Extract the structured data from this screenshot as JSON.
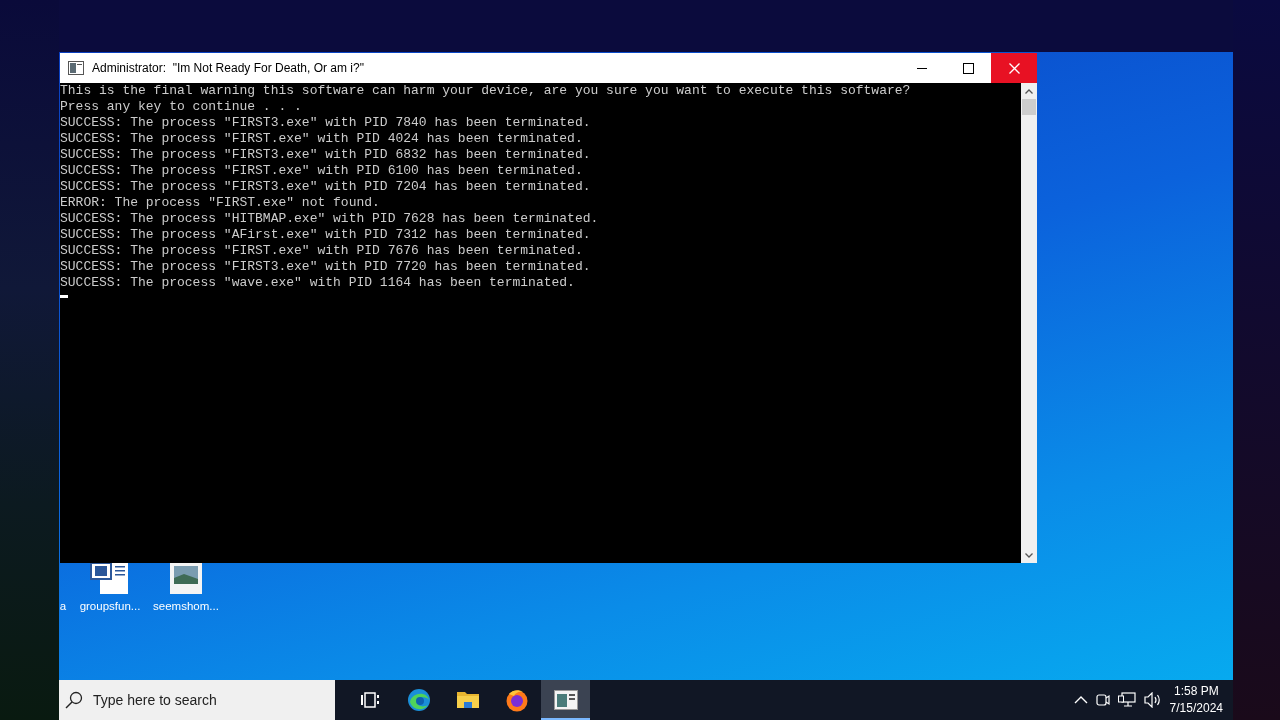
{
  "console_window": {
    "title": "Administrator:  \"Im Not Ready For Death, Or am i?\"",
    "lines": [
      {
        "text": "This is the final warning this software can harm your device, are you sure you want to execute this software?"
      },
      {
        "text": "Press any key to continue . . ."
      },
      {
        "text": "SUCCESS: The process \"FIRST3.exe\" with PID 7840 has been terminated."
      },
      {
        "text": "SUCCESS: The process \"FIRST.exe\" with PID 4024 has been terminated."
      },
      {
        "text": "SUCCESS: The process \"FIRST3.exe\" with PID 6832 has been terminated."
      },
      {
        "text": "SUCCESS: The process \"FIRST.exe\" with PID 6100 has been terminated."
      },
      {
        "text": "SUCCESS: The process \"FIRST3.exe\" with PID 7204 has been terminated."
      },
      {
        "text": "ERROR: The process \"FIRST.exe\" not found."
      },
      {
        "text": "SUCCESS: The process \"HITBMAP.exe\" with PID 7628 has been terminated."
      },
      {
        "text": "SUCCESS: The process \"AFirst.exe\" with PID 7312 has been terminated."
      },
      {
        "text": "SUCCESS: The process \"FIRST.exe\" with PID 7676 has been terminated."
      },
      {
        "text": "SUCCESS: The process \"FIRST3.exe\" with PID 7720 has been terminated."
      },
      {
        "text": "SUCCESS: The process \"wave.exe\" with PID 1164 has been terminated."
      }
    ]
  },
  "desktop_icons": [
    {
      "label": "a",
      "kind": "none"
    },
    {
      "label": "groupsfun...",
      "kind": "document"
    },
    {
      "label": "seemshom...",
      "kind": "image"
    }
  ],
  "taskbar": {
    "search": {
      "placeholder": "Type here to search"
    },
    "apps": [
      {
        "kind": "taskview",
        "selected": false
      },
      {
        "kind": "browser",
        "selected": false
      },
      {
        "kind": "folder",
        "selected": false
      },
      {
        "kind": "firefox",
        "selected": false
      },
      {
        "kind": "console",
        "selected": true
      }
    ],
    "clock": {
      "time": "1:58 PM",
      "date": "7/15/2024"
    }
  }
}
